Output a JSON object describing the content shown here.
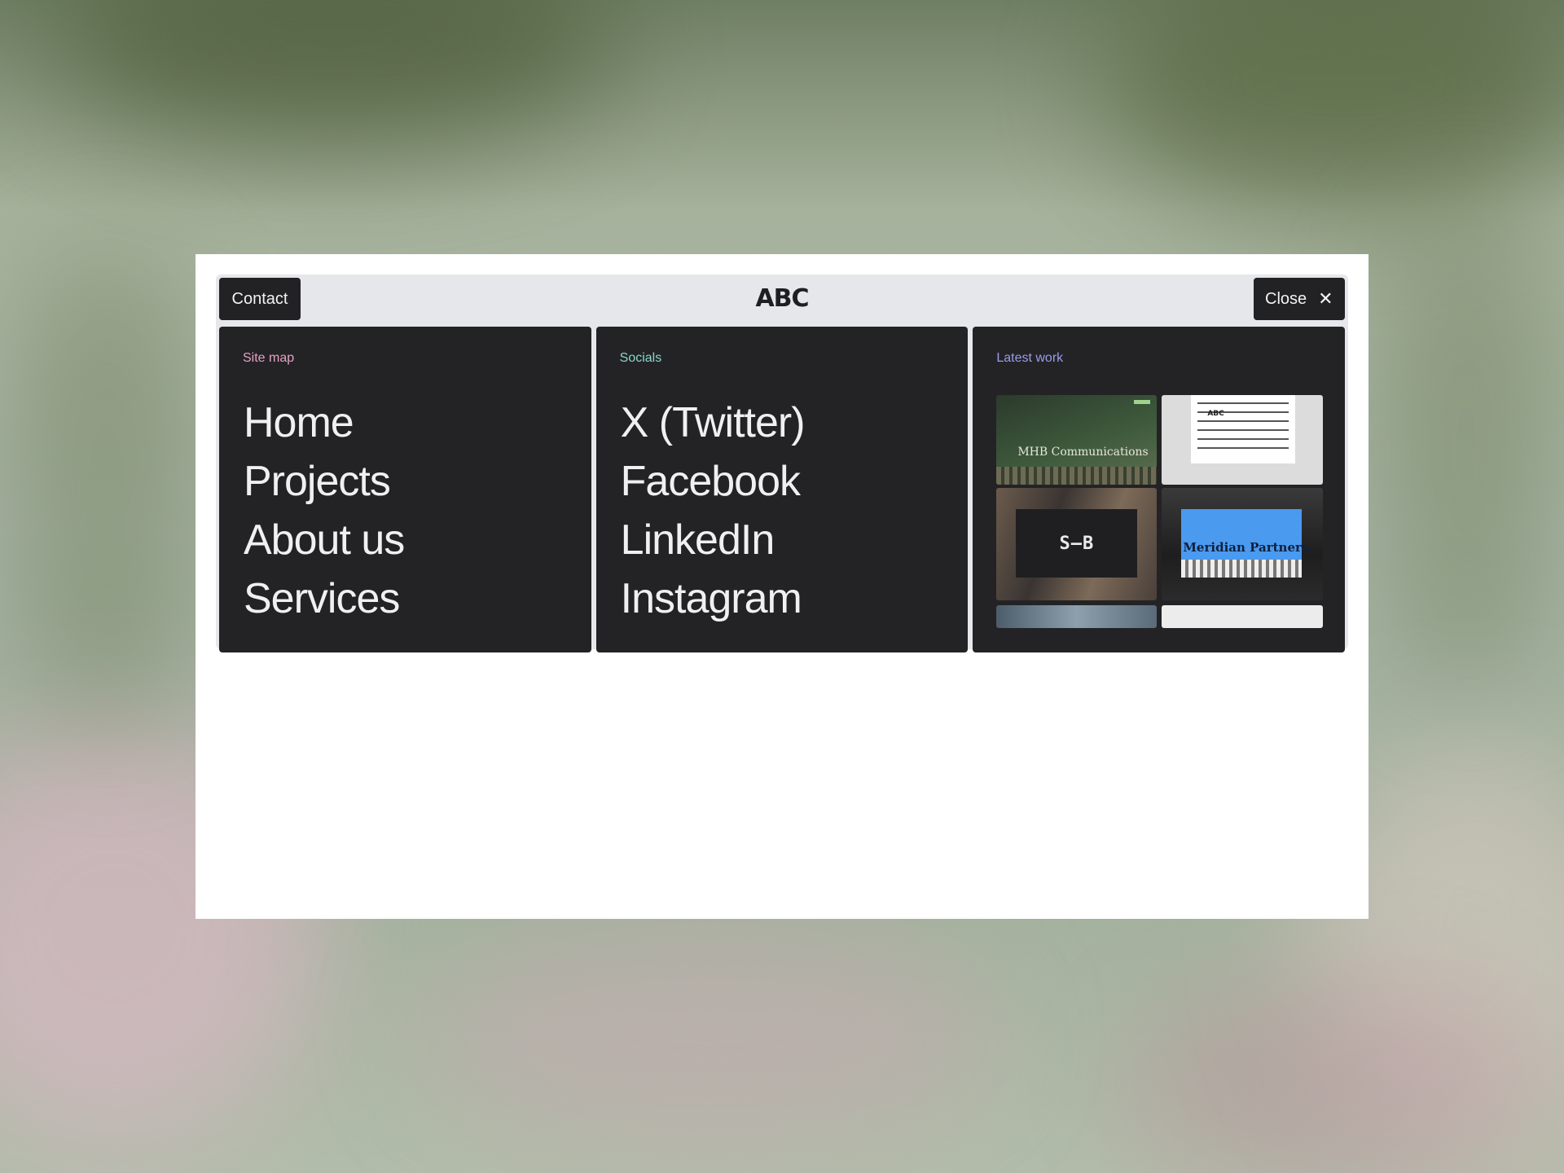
{
  "header": {
    "contact_label": "Contact",
    "logo_text": "ABC",
    "close_label": "Close",
    "close_icon": "close-icon"
  },
  "sitemap": {
    "title": "Site map",
    "items": [
      "Home",
      "Projects",
      "About us",
      "Services"
    ]
  },
  "socials": {
    "title": "Socials",
    "items": [
      "X (Twitter)",
      "Facebook",
      "LinkedIn",
      "Instagram"
    ]
  },
  "latest": {
    "title": "Latest work",
    "thumbs": {
      "mhb_caption": "MHB Communications",
      "doc_logo": "ABC",
      "sb_mark": "S—B",
      "meridian_caption": "Meridian Partners."
    }
  },
  "colors": {
    "panel_bg": "#232326",
    "sitemap_accent": "#e5a2c2",
    "socials_accent": "#8ad8c8",
    "latest_accent": "#9a9ce8"
  }
}
